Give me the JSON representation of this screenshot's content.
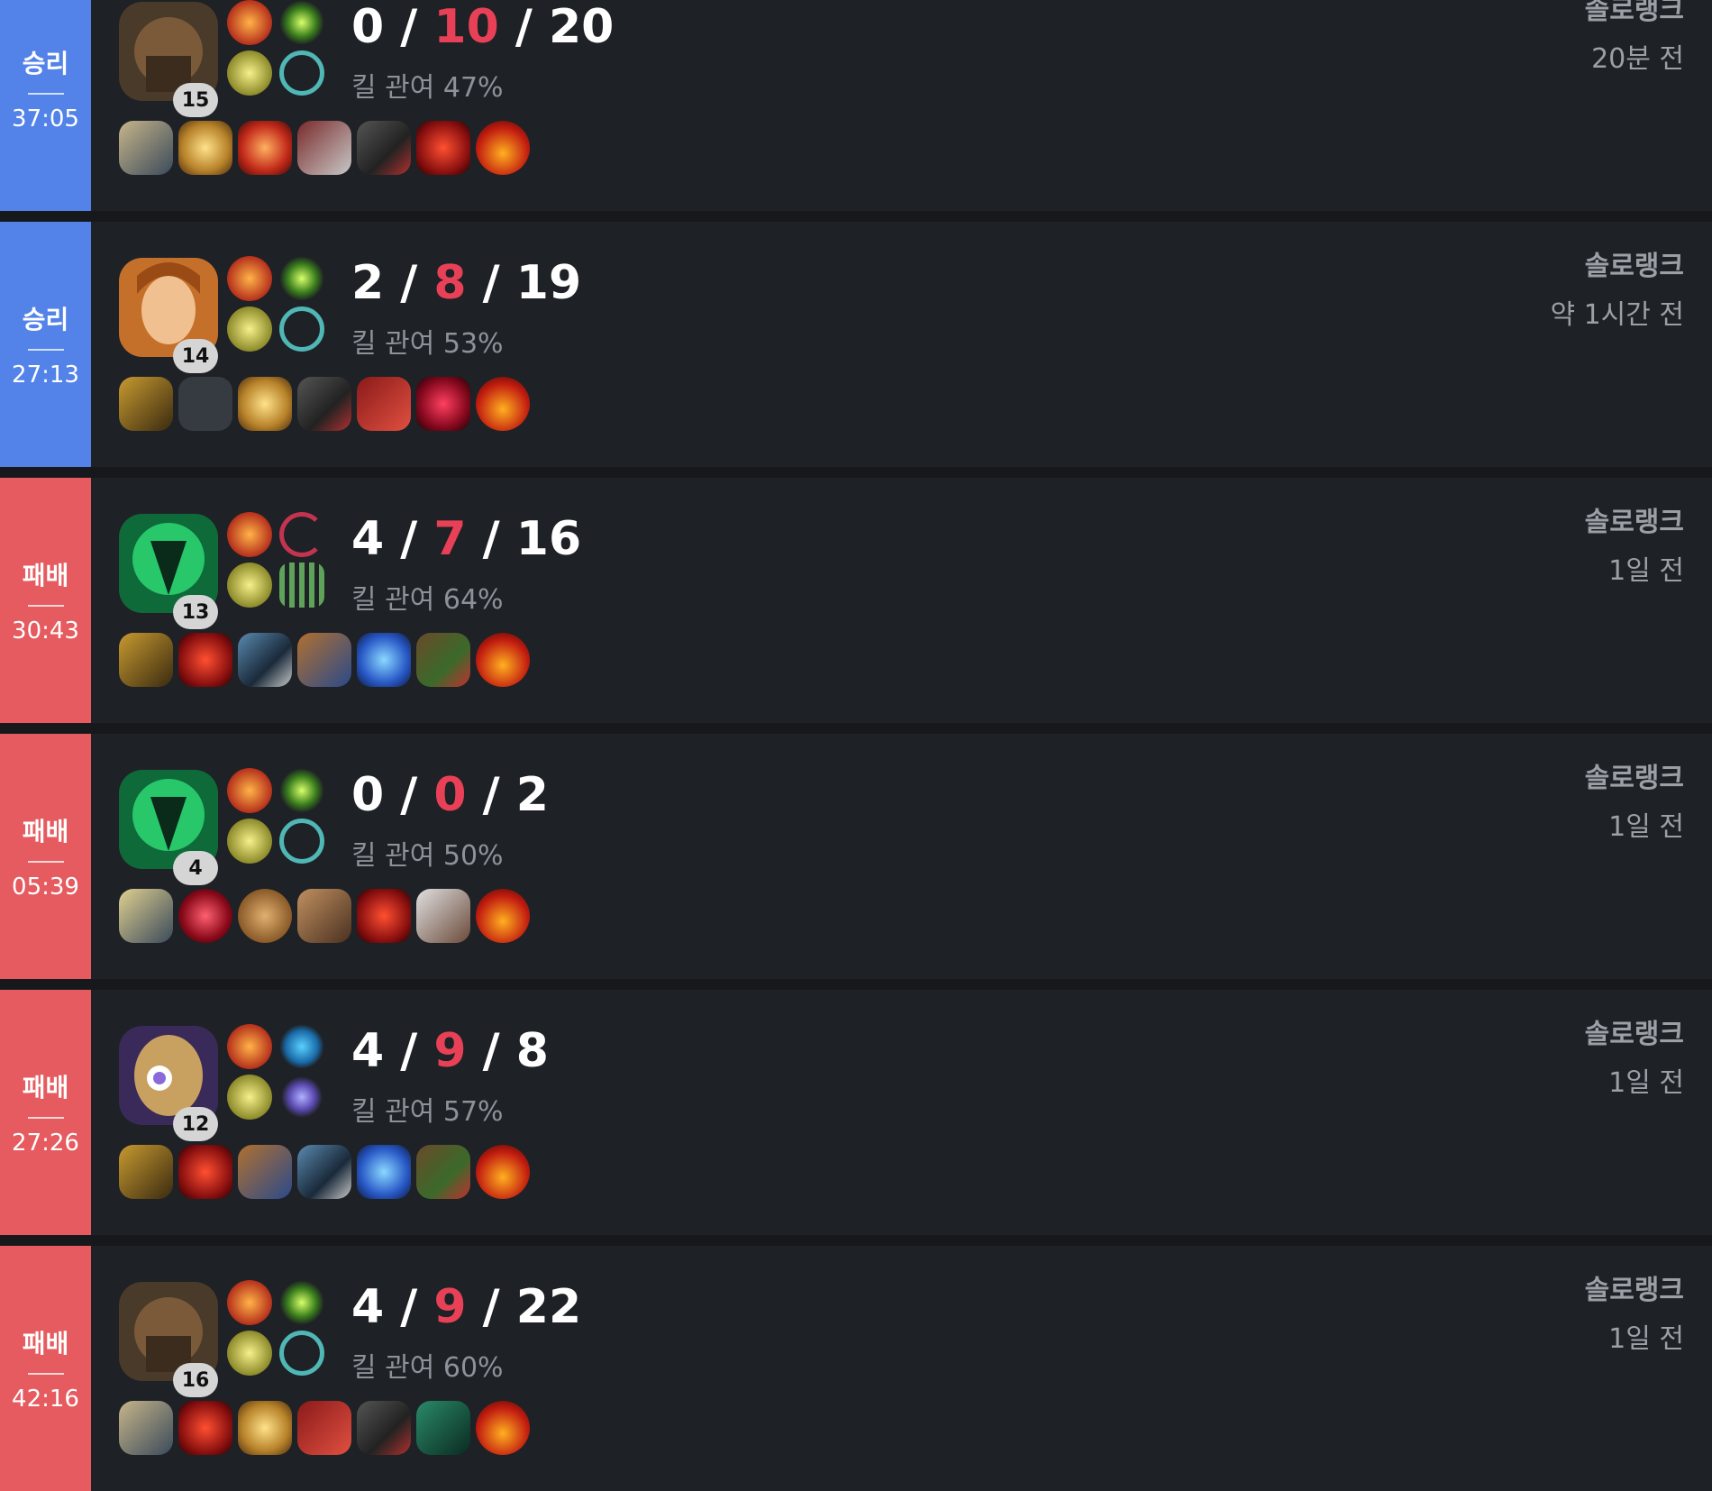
{
  "matches": [
    {
      "result": "승리",
      "duration": "37:05",
      "level": "15",
      "kills": "0",
      "deaths": "10",
      "assists": "20",
      "kill_participation": "킬 관여 47%",
      "queue": "솔로랭크",
      "time_ago": "20분 전"
    },
    {
      "result": "승리",
      "duration": "27:13",
      "level": "14",
      "kills": "2",
      "deaths": "8",
      "assists": "19",
      "kill_participation": "킬 관여 53%",
      "queue": "솔로랭크",
      "time_ago": "약 1시간 전"
    },
    {
      "result": "패배",
      "duration": "30:43",
      "level": "13",
      "kills": "4",
      "deaths": "7",
      "assists": "16",
      "kill_participation": "킬 관여 64%",
      "queue": "솔로랭크",
      "time_ago": "1일 전"
    },
    {
      "result": "패배",
      "duration": "05:39",
      "level": "4",
      "kills": "0",
      "deaths": "0",
      "assists": "2",
      "kill_participation": "킬 관여 50%",
      "queue": "솔로랭크",
      "time_ago": "1일 전"
    },
    {
      "result": "패배",
      "duration": "27:26",
      "level": "12",
      "kills": "4",
      "deaths": "9",
      "assists": "8",
      "kill_participation": "킬 관여 57%",
      "queue": "솔로랭크",
      "time_ago": "1일 전"
    },
    {
      "result": "패배",
      "duration": "42:16",
      "level": "16",
      "kills": "4",
      "deaths": "9",
      "assists": "22",
      "kill_participation": "킬 관여 60%",
      "queue": "솔로랭크",
      "time_ago": "1일 전"
    }
  ],
  "colors": {
    "win": "#5383e8",
    "loss": "#e55b5f",
    "deaths": "#e84057",
    "card": "#1e2125",
    "background": "#16181c"
  }
}
